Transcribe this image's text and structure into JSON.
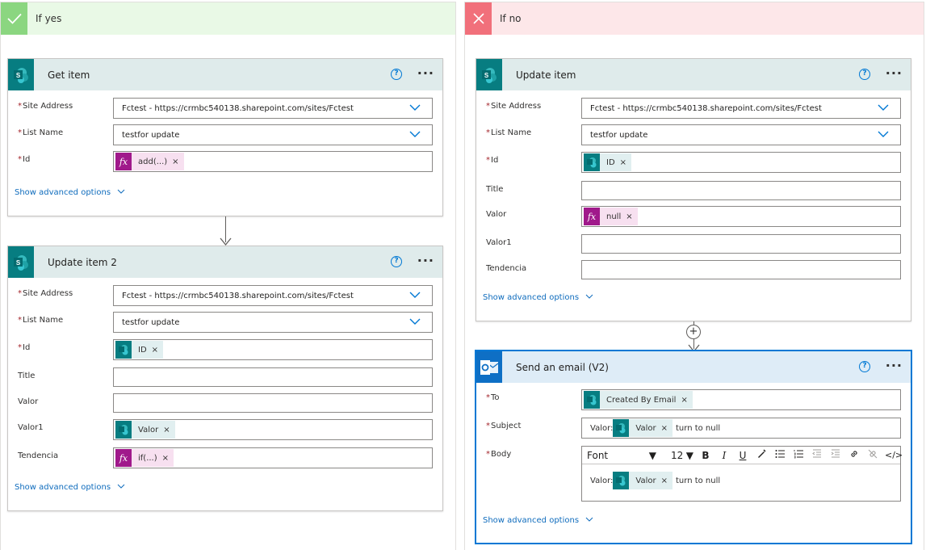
{
  "branches": {
    "yes": {
      "title": "If yes"
    },
    "no": {
      "title": "If no"
    }
  },
  "labels": {
    "site_address": "Site Address",
    "list_name": "List Name",
    "id": "Id",
    "title": "Title",
    "valor": "Valor",
    "valor1": "Valor1",
    "tendencia": "Tendencia",
    "to": "To",
    "subject": "Subject",
    "body": "Body",
    "required_mark": "*",
    "show_advanced": "Show advanced options",
    "help": "?",
    "more": "···",
    "remove": "×"
  },
  "get_item": {
    "title": "Get item",
    "site_address": "Fctest - https://crmbc540138.sharepoint.com/sites/Fctest",
    "list_name": "testfor update",
    "id_token": "add(...)"
  },
  "update_item_2": {
    "title": "Update item 2",
    "site_address": "Fctest - https://crmbc540138.sharepoint.com/sites/Fctest",
    "list_name": "testfor update",
    "id_token": "ID",
    "valor1_token": "Valor",
    "tendencia_token": "if(...)"
  },
  "update_item": {
    "title": "Update item",
    "site_address": "Fctest - https://crmbc540138.sharepoint.com/sites/Fctest",
    "list_name": "testfor update",
    "id_token": "ID",
    "valor_token": "null"
  },
  "send_email": {
    "title": "Send an email (V2)",
    "to_token": "Created By Email",
    "subject_prefix": "Valor:",
    "subject_token": "Valor",
    "subject_suffix": "turn to null",
    "body_prefix": "Valor:",
    "body_token": "Valor",
    "body_suffix": "turn to null",
    "toolbar": {
      "font": "Font",
      "size": "12",
      "bold": "B",
      "italic": "I",
      "underline": "U",
      "code": "</>"
    }
  },
  "colors": {
    "yes_header": "#e9f9e6",
    "yes_badge": "#8bd680",
    "no_header": "#fde7e9",
    "no_badge": "#f1707b",
    "sharepoint": "#077d81",
    "outlook": "#0e6fc5",
    "expression": "#a0198b",
    "link": "#0f6cbd",
    "selected_border": "#0078d4"
  }
}
